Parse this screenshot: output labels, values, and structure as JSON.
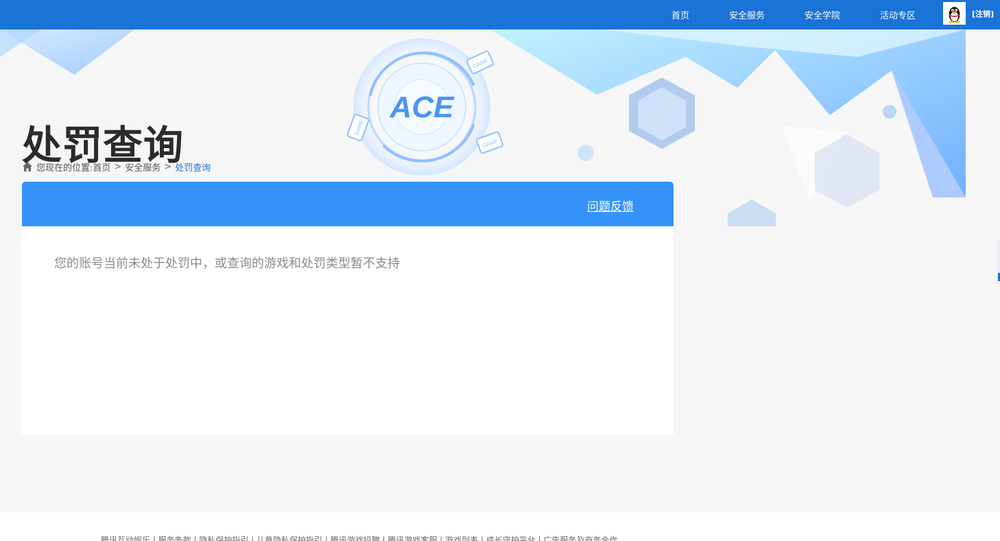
{
  "topbar": {
    "nav": [
      "首页",
      "安全服务",
      "安全学院",
      "活动专区"
    ],
    "logout": "[注销]"
  },
  "banner": {
    "title": "处罚查询",
    "logo_text": "ACE",
    "badge_text": "GAME"
  },
  "breadcrumb": {
    "prefix": "您现在的位置:",
    "items": [
      "首页",
      "安全服务",
      "处罚查询"
    ],
    "separator": ">"
  },
  "panel": {
    "feedback": "问题反馈",
    "notice": "您的账号当前未处于处罚中，或查询的游戏和处罚类型暂不支持"
  },
  "footer": {
    "links": "腾讯互动娱乐 | 服务条款 | 隐私保护指引 | 儿童隐私保护指引 | 腾讯游戏招聘 | 腾讯游戏客服 | 游戏列表 | 成长守护平台 | 广告服务及商务合作"
  },
  "colors": {
    "topbar": "#1a73d6",
    "panel_header": "#3592f9",
    "title": "#2b2b2b",
    "breadcrumb_current": "#1a73d6"
  }
}
